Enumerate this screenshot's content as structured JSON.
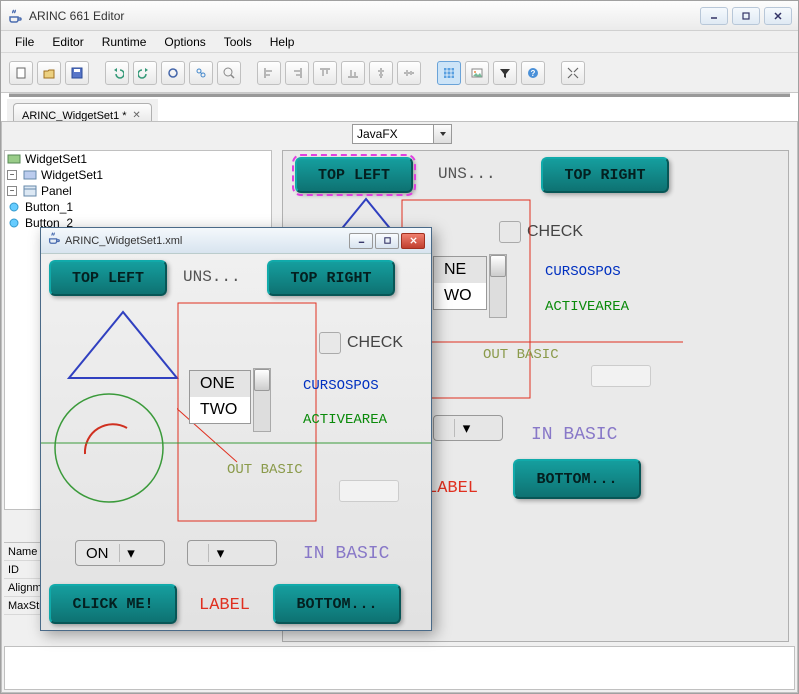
{
  "window": {
    "title": "ARINC 661 Editor",
    "controls": {
      "min": "minimize",
      "max": "maximize",
      "close": "close"
    }
  },
  "menu": {
    "items": [
      "File",
      "Editor",
      "Runtime",
      "Options",
      "Tools",
      "Help"
    ]
  },
  "tabs": {
    "active": {
      "label": "ARINC_WidgetSet1 *"
    }
  },
  "renderer_select": {
    "value": "JavaFX"
  },
  "tree": {
    "root": "WidgetSet1",
    "n1": "WidgetSet1",
    "n2": "Panel",
    "n3": "Button_1",
    "n4": "Button_2"
  },
  "props": {
    "rows": [
      "Name",
      "ID",
      "Alignment",
      "MaxStringLength"
    ]
  },
  "canvas": {
    "btn_tl": "TOP LEFT",
    "uns": "UNS...",
    "btn_tr": "TOP RIGHT",
    "check": "CHECK",
    "list_one": "NE",
    "list_two": "WO",
    "cursospos": "CURSOSPOS",
    "activearea": "ACTIVEAREA",
    "outbasic": "OUT BASIC",
    "inbasic": "IN BASIC",
    "label": "LABEL",
    "btn_br": "BOTTOM..."
  },
  "child": {
    "title": "ARINC_WidgetSet1.xml",
    "btn_tl": "TOP LEFT",
    "uns": "UNS...",
    "btn_tr": "TOP RIGHT",
    "check": "CHECK",
    "list_one": "ONE",
    "list_two": "TWO",
    "cursospos": "CURSOSPOS",
    "activearea": "ACTIVEAREA",
    "outbasic": "OUT BASIC",
    "inbasic": "IN BASIC",
    "combo_on": "ON",
    "btn_click": "CLICK ME!",
    "label": "LABEL",
    "btn_br": "BOTTOM..."
  }
}
